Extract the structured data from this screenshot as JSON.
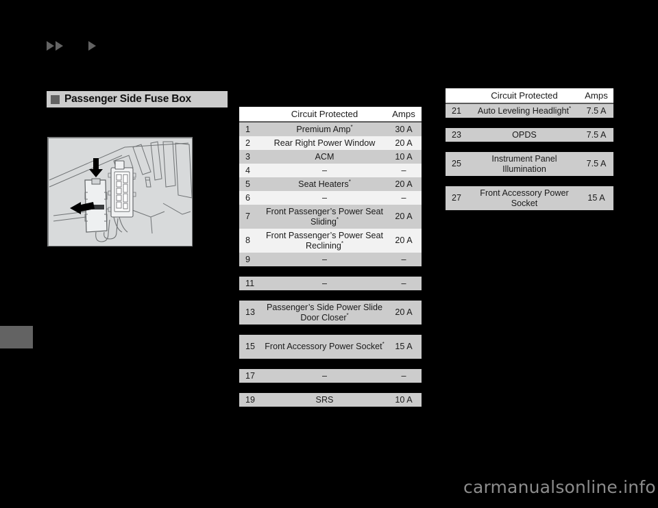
{
  "nav": {
    "back_icon": "double-triangle-right-icon",
    "forward_icon": "triangle-right-icon"
  },
  "section": {
    "bullet_icon": "square-bullet-icon",
    "title": "Passenger Side Fuse Box"
  },
  "figure": {
    "name": "passenger-side-fuse-box-illustration",
    "alt": "Fuse box cover removal illustration with press and pull arrows"
  },
  "table_left": {
    "headers": {
      "number": "",
      "circuit": "Circuit Protected",
      "amps": "Amps"
    },
    "rows": [
      {
        "num": "1",
        "circuit": "Premium Amp",
        "star": "*",
        "amps": "30 A",
        "lines": 1,
        "shade": "grey"
      },
      {
        "num": "2",
        "circuit": "Rear Right Power Window",
        "star": "",
        "amps": "20 A",
        "lines": 1,
        "shade": "white"
      },
      {
        "num": "3",
        "circuit": "ACM",
        "star": "",
        "amps": "10 A",
        "lines": 1,
        "shade": "grey"
      },
      {
        "num": "4",
        "circuit": "–",
        "star": "",
        "amps": "–",
        "lines": 1,
        "shade": "white"
      },
      {
        "num": "5",
        "circuit": "Seat Heaters",
        "star": "*",
        "amps": "20 A",
        "lines": 1,
        "shade": "grey"
      },
      {
        "num": "6",
        "circuit": "–",
        "star": "",
        "amps": "–",
        "lines": 1,
        "shade": "white"
      },
      {
        "num": "7",
        "circuit": "Front Passenger’s Power Seat Sliding",
        "star": "*",
        "amps": "20 A",
        "lines": 2,
        "shade": "grey"
      },
      {
        "num": "8",
        "circuit": "Front Passenger’s Power Seat Reclining",
        "star": "*",
        "amps": "20 A",
        "lines": 2,
        "shade": "white"
      },
      {
        "num": "9",
        "circuit": "–",
        "star": "",
        "amps": "–",
        "lines": 1,
        "shade": "grey"
      },
      {
        "spacer": true
      },
      {
        "num": "11",
        "circuit": "–",
        "star": "",
        "amps": "–",
        "lines": 1,
        "shade": "grey"
      },
      {
        "spacer": true
      },
      {
        "num": "13",
        "circuit": "Passenger’s Side Power Slide Door Closer",
        "star": "*",
        "amps": "20 A",
        "lines": 2,
        "shade": "grey"
      },
      {
        "spacer": true
      },
      {
        "num": "15",
        "circuit": "Front Accessory Power Socket",
        "star": "*",
        "amps": "15 A",
        "lines": 2,
        "shade": "grey"
      },
      {
        "spacer": true
      },
      {
        "num": "17",
        "circuit": "–",
        "star": "",
        "amps": "–",
        "lines": 1,
        "shade": "grey"
      },
      {
        "spacer": true
      },
      {
        "num": "19",
        "circuit": "SRS",
        "star": "",
        "amps": "10 A",
        "lines": 1,
        "shade": "grey"
      }
    ]
  },
  "table_right": {
    "headers": {
      "number": "",
      "circuit": "Circuit Protected",
      "amps": "Amps"
    },
    "rows": [
      {
        "num": "21",
        "circuit": "Auto Leveling Headlight",
        "star": "*",
        "amps": "7.5 A",
        "lines": 1,
        "shade": "grey"
      },
      {
        "spacer": true
      },
      {
        "num": "23",
        "circuit": "OPDS",
        "star": "",
        "amps": "7.5 A",
        "lines": 1,
        "shade": "grey"
      },
      {
        "spacer": true
      },
      {
        "num": "25",
        "circuit": "Instrument Panel Illumination",
        "star": "",
        "amps": "7.5 A",
        "lines": 2,
        "shade": "grey"
      },
      {
        "spacer": true
      },
      {
        "num": "27",
        "circuit": "Front Accessory Power Socket",
        "star": "",
        "amps": "15 A",
        "lines": 2,
        "shade": "grey"
      }
    ]
  },
  "watermark": {
    "text": "carmanualsonline.info"
  },
  "colors": {
    "page_background": "#000000",
    "row_grey": "#cccccc",
    "row_white": "#f2f2f2",
    "header_bar": "#cccccc",
    "accent_grey": "#636363",
    "figure_background": "#d8dadb",
    "watermark": "#8c8c8c"
  }
}
